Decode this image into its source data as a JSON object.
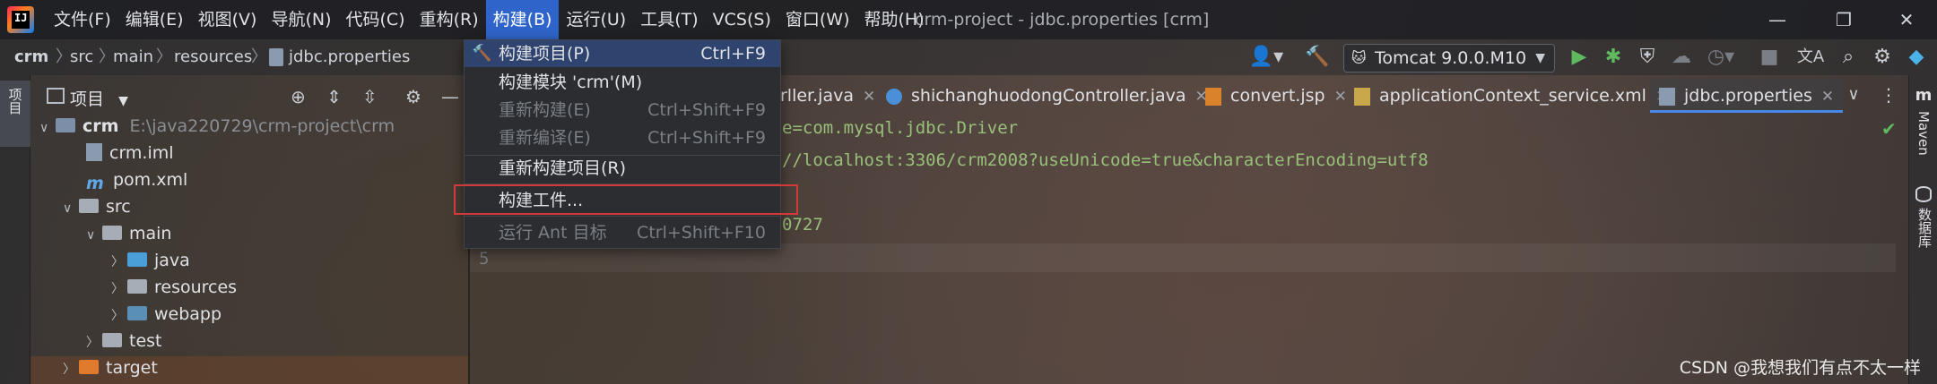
{
  "menubar": {
    "logo_text": "IJ",
    "items": [
      "文件(F)",
      "编辑(E)",
      "视图(V)",
      "导航(N)",
      "代码(C)",
      "重构(R)",
      "构建(B)",
      "运行(U)",
      "工具(T)",
      "VCS(S)",
      "窗口(W)",
      "帮助(H)"
    ],
    "title": "crm-project - jdbc.properties [crm]",
    "controls": {
      "minimize": "—",
      "restore": "❐",
      "close": "✕"
    }
  },
  "breadcrumb": [
    "crm",
    "src",
    "main",
    "resources",
    "jdbc.properties"
  ],
  "toolbar": {
    "run_config": "Tomcat 9.0.0.M10",
    "icons": [
      "user-icon",
      "hammer-icon",
      "run-icon",
      "debug-icon",
      "coverage-icon",
      "profile-icon",
      "more-run-icon",
      "stop-icon",
      "translate-icon",
      "search-icon",
      "settings-icon",
      "plugin-icon"
    ]
  },
  "left_strip": {
    "project_tab": "项目"
  },
  "project_panel": {
    "title": "项目",
    "tree": [
      {
        "name": "crm",
        "path": "E:\\java220729\\crm-project\\crm",
        "indent": 0,
        "arrow": "v",
        "kind": "module"
      },
      {
        "name": "crm.iml",
        "indent": 1,
        "arrow": "",
        "kind": "iml"
      },
      {
        "name": "pom.xml",
        "indent": 1,
        "arrow": "",
        "kind": "maven"
      },
      {
        "name": "src",
        "indent": 1,
        "arrow": "v",
        "kind": "folder"
      },
      {
        "name": "main",
        "indent": 2,
        "arrow": "v",
        "kind": "folder"
      },
      {
        "name": "java",
        "indent": 3,
        "arrow": ">",
        "kind": "folder-blue"
      },
      {
        "name": "resources",
        "indent": 3,
        "arrow": ">",
        "kind": "folder"
      },
      {
        "name": "webapp",
        "indent": 3,
        "arrow": ">",
        "kind": "folder-web"
      },
      {
        "name": "test",
        "indent": 2,
        "arrow": ">",
        "kind": "folder"
      },
      {
        "name": "target",
        "indent": 1,
        "arrow": ">",
        "kind": "folder-orange"
      }
    ]
  },
  "editor": {
    "tabs": [
      {
        "label": "rller.java",
        "active": false
      },
      {
        "label": "shichanghuodongController.java",
        "active": false
      },
      {
        "label": "convert.jsp",
        "active": false
      },
      {
        "label": "applicationContext_service.xml",
        "active": false
      },
      {
        "label": "jdbc.properties",
        "active": true
      }
    ],
    "lines": [
      {
        "num": "",
        "text": "e=com.mysql.jdbc.Driver"
      },
      {
        "num": "",
        "text": "//localhost:3306/crm2008?useUnicode=true&characterEncoding=utf8"
      },
      {
        "num": "",
        "text": ""
      },
      {
        "num": "",
        "text": "0727"
      },
      {
        "num": "5",
        "text": ""
      }
    ]
  },
  "build_menu": {
    "items": [
      {
        "label": "构建项目(P)",
        "shortcut": "Ctrl+F9",
        "disabled": false,
        "icon": "hammer-icon"
      },
      {
        "label": "构建模块 'crm'(M)",
        "shortcut": "",
        "disabled": false
      },
      {
        "label": "重新构建(E)",
        "shortcut": "Ctrl+Shift+F9",
        "disabled": true
      },
      {
        "label": "重新编译(E)",
        "shortcut": "Ctrl+Shift+F9",
        "disabled": true
      },
      {
        "label": "重新构建项目(R)",
        "shortcut": "",
        "disabled": false
      },
      {
        "label": "构建工件...",
        "shortcut": "",
        "disabled": false
      },
      {
        "label": "运行 Ant 目标",
        "shortcut": "Ctrl+Shift+F10",
        "disabled": true
      }
    ]
  },
  "right_strip": {
    "maven": "Maven",
    "database": "数据库"
  },
  "watermark": "CSDN @我想我们有点不太一样",
  "colors": {
    "accent": "#2f65ca",
    "highlight_box": "#d23a3a",
    "code": "#99c07a"
  }
}
